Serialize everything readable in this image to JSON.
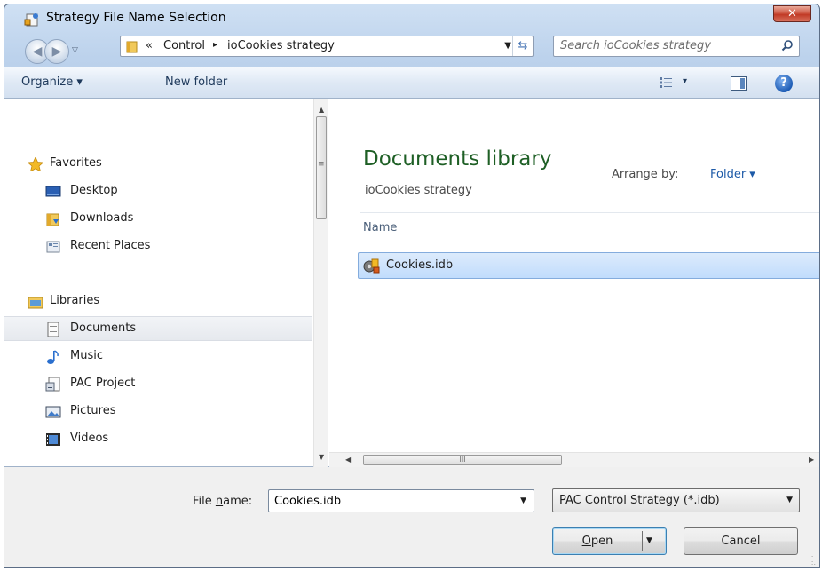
{
  "window": {
    "title": "Strategy File Name Selection",
    "close_label": "✕"
  },
  "nav": {
    "back_icon": "back-arrow-icon",
    "forward_icon": "forward-arrow-icon",
    "address": {
      "overflow_chevron": "«",
      "segments": [
        "Control",
        "ioCookies strategy"
      ],
      "separator": "▸"
    },
    "search_placeholder": "Search ioCookies strategy"
  },
  "toolbar": {
    "organize_label": "Organize ▾",
    "new_folder_label": "New folder",
    "views_dropdown": "▾",
    "help_label": "?"
  },
  "navpane": {
    "favorites": {
      "label": "Favorites",
      "icon": "star-icon",
      "items": [
        {
          "label": "Desktop",
          "icon": "desktop-icon"
        },
        {
          "label": "Downloads",
          "icon": "downloads-folder-icon"
        },
        {
          "label": "Recent Places",
          "icon": "recent-places-icon"
        }
      ]
    },
    "libraries": {
      "label": "Libraries",
      "icon": "libraries-icon",
      "items": [
        {
          "label": "Documents",
          "icon": "documents-icon",
          "selected": true
        },
        {
          "label": "Music",
          "icon": "music-icon"
        },
        {
          "label": "PAC Project",
          "icon": "pac-project-icon"
        },
        {
          "label": "Pictures",
          "icon": "pictures-icon"
        },
        {
          "label": "Videos",
          "icon": "videos-icon"
        }
      ]
    }
  },
  "filepane": {
    "library_title": "Documents library",
    "library_subtitle": "ioCookies strategy",
    "arrange_label": "Arrange by:",
    "arrange_value": "Folder ▾",
    "column_name": "Name",
    "files": [
      {
        "name": "Cookies.idb",
        "icon": "strategy-file-icon",
        "selected": true
      }
    ]
  },
  "scrollbar": {
    "thumb_grip": "III"
  },
  "bottom": {
    "file_name_label_pre": "File ",
    "file_name_label_underlined": "n",
    "file_name_label_post": "ame:",
    "file_name_value": "Cookies.idb",
    "file_type_value": "PAC Control Strategy (*.idb)",
    "open_label_underlined": "O",
    "open_label_rest": "pen",
    "cancel_label": "Cancel"
  },
  "colors": {
    "library_title": "#1e5f25",
    "selection": "#c1dcfc",
    "toolbar_text": "#1e395b"
  }
}
